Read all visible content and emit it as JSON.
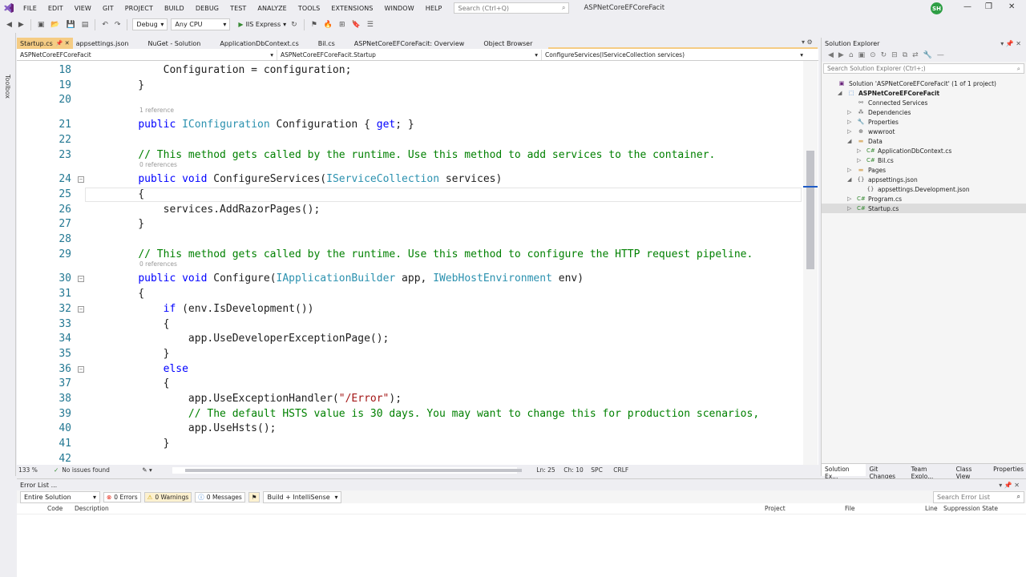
{
  "menubar": {
    "items": [
      "FILE",
      "EDIT",
      "VIEW",
      "GIT",
      "PROJECT",
      "BUILD",
      "DEBUG",
      "TEST",
      "ANALYZE",
      "TOOLS",
      "EXTENSIONS",
      "WINDOW",
      "HELP"
    ],
    "search_placeholder": "Search (Ctrl+Q)",
    "solution_name": "ASPNetCoreEFCoreFacit",
    "avatar_initials": "SH"
  },
  "toolbar": {
    "config": "Debug",
    "platform": "Any CPU",
    "run_target": "IIS Express"
  },
  "toolbox_label": "Toolbox",
  "tabs": [
    {
      "label": "Startup.cs",
      "active": true
    },
    {
      "label": "appsettings.json"
    },
    {
      "label": "NuGet - Solution"
    },
    {
      "label": "ApplicationDbContext.cs"
    },
    {
      "label": "Bil.cs"
    },
    {
      "label": "ASPNetCoreEFCoreFacit: Overview"
    },
    {
      "label": "Object Browser"
    }
  ],
  "navbar": {
    "project": "ASPNetCoreEFCoreFacit",
    "class": "ASPNetCoreEFCoreFacit.Startup",
    "member": "ConfigureServices(IServiceCollection services)"
  },
  "code_lines": [
    {
      "n": "18",
      "code": "        Configuration = configuration;"
    },
    {
      "n": "19",
      "code": "    }"
    },
    {
      "n": "20",
      "code": ""
    },
    {
      "n": "21",
      "code": "    public IConfiguration Configuration { get; }",
      "ref": "1 reference"
    },
    {
      "n": "22",
      "code": ""
    },
    {
      "n": "23",
      "code": "    // This method gets called by the runtime. Use this method to add services to the container."
    },
    {
      "n": "24",
      "code": "    public void ConfigureServices(IServiceCollection services)",
      "ref": "0 references"
    },
    {
      "n": "25",
      "code": "    {"
    },
    {
      "n": "26",
      "code": "        services.AddRazorPages();"
    },
    {
      "n": "27",
      "code": "    }"
    },
    {
      "n": "28",
      "code": ""
    },
    {
      "n": "29",
      "code": "    // This method gets called by the runtime. Use this method to configure the HTTP request pipeline."
    },
    {
      "n": "30",
      "code": "    public void Configure(IApplicationBuilder app, IWebHostEnvironment env)",
      "ref": "0 references"
    },
    {
      "n": "31",
      "code": "    {"
    },
    {
      "n": "32",
      "code": "        if (env.IsDevelopment())"
    },
    {
      "n": "33",
      "code": "        {"
    },
    {
      "n": "34",
      "code": "            app.UseDeveloperExceptionPage();"
    },
    {
      "n": "35",
      "code": "        }"
    },
    {
      "n": "36",
      "code": "        else"
    },
    {
      "n": "37",
      "code": "        {"
    },
    {
      "n": "38",
      "code": "            app.UseExceptionHandler(\"/Error\");"
    },
    {
      "n": "39",
      "code": "            // The default HSTS value is 30 days. You may want to change this for production scenarios,"
    },
    {
      "n": "40",
      "code": "            app.UseHsts();"
    },
    {
      "n": "41",
      "code": "        }"
    },
    {
      "n": "42",
      "code": ""
    }
  ],
  "editor_status": {
    "zoom": "133 %",
    "issues": "No issues found",
    "ln": "Ln: 25",
    "ch": "Ch: 10",
    "spc": "SPC",
    "crlf": "CRLF"
  },
  "solution_explorer": {
    "title": "Solution Explorer",
    "search_placeholder": "Search Solution Explorer (Ctrl+;)",
    "tree": [
      {
        "label": "Solution 'ASPNetCoreEFCoreFacit' (1 of 1 project)",
        "indent": 0,
        "icon": "solution-icon"
      },
      {
        "label": "ASPNetCoreEFCoreFacit",
        "indent": 1,
        "icon": "project-icon",
        "bold": true,
        "expanded": true
      },
      {
        "label": "Connected Services",
        "indent": 2,
        "icon": "connected-icon"
      },
      {
        "label": "Dependencies",
        "indent": 2,
        "icon": "dependencies-icon",
        "collapsed": true
      },
      {
        "label": "Properties",
        "indent": 2,
        "icon": "wrench-icon",
        "collapsed": true
      },
      {
        "label": "wwwroot",
        "indent": 2,
        "icon": "globe-icon",
        "collapsed": true
      },
      {
        "label": "Data",
        "indent": 2,
        "icon": "folder-icon",
        "expanded": true
      },
      {
        "label": "ApplicationDbContext.cs",
        "indent": 3,
        "icon": "csharp-icon",
        "collapsed": true
      },
      {
        "label": "Bil.cs",
        "indent": 3,
        "icon": "csharp-icon",
        "collapsed": true
      },
      {
        "label": "Pages",
        "indent": 2,
        "icon": "folder-icon",
        "collapsed": true
      },
      {
        "label": "appsettings.json",
        "indent": 2,
        "icon": "json-icon",
        "expanded": true
      },
      {
        "label": "appsettings.Development.json",
        "indent": 3,
        "icon": "json-icon"
      },
      {
        "label": "Program.cs",
        "indent": 2,
        "icon": "csharp-icon",
        "collapsed": true
      },
      {
        "label": "Startup.cs",
        "indent": 2,
        "icon": "csharp-icon",
        "collapsed": true,
        "selected": true
      }
    ],
    "bottom_tabs": [
      "Solution Ex...",
      "Git Changes",
      "Team Explo...",
      "Class View",
      "Properties"
    ]
  },
  "error_list": {
    "title": "Error List ...",
    "scope": "Entire Solution",
    "errors": "0 Errors",
    "warnings": "0 Warnings",
    "messages": "0 Messages",
    "build_filter": "Build + IntelliSense",
    "search_placeholder": "Search Error List",
    "columns": [
      "Code",
      "Description",
      "Project",
      "File",
      "Line",
      "Suppression State"
    ]
  }
}
